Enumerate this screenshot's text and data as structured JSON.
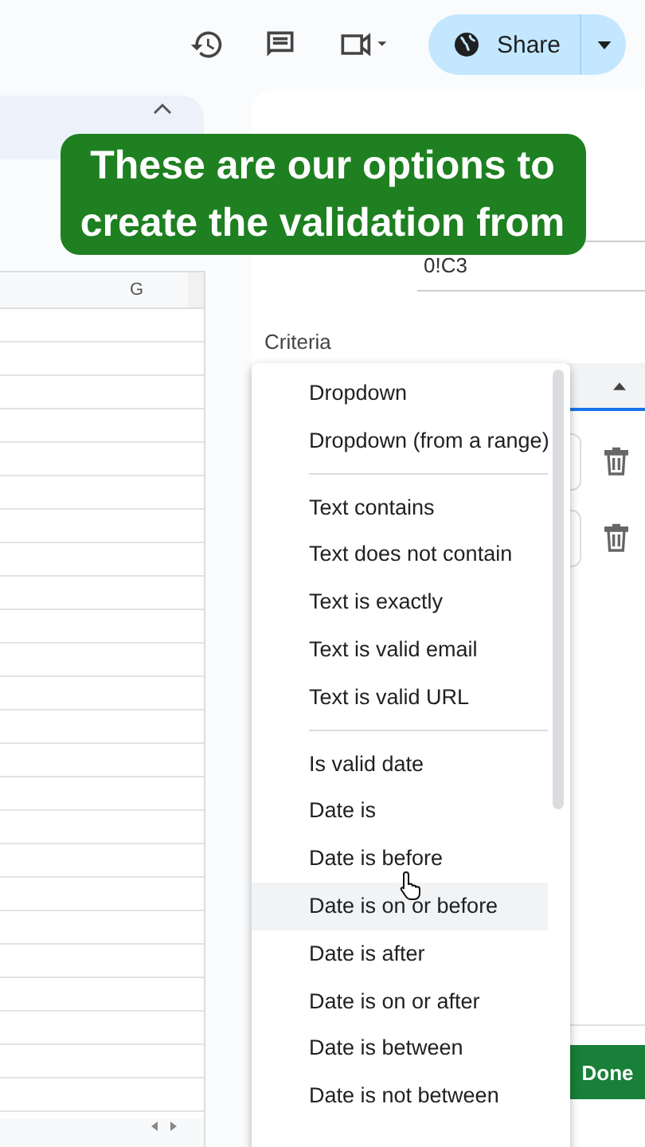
{
  "toolbar": {
    "share_label": "Share"
  },
  "caption": "These are our options to create the validation from",
  "sheet": {
    "column_header": "G"
  },
  "panel": {
    "range_text": "0!C3",
    "criteria_label": "Criteria",
    "done_label": "Done"
  },
  "menu": {
    "groups": [
      [
        {
          "label": "Dropdown",
          "highlighted": false
        },
        {
          "label": "Dropdown (from a range)",
          "highlighted": false
        }
      ],
      [
        {
          "label": "Text contains",
          "highlighted": false
        },
        {
          "label": "Text does not contain",
          "highlighted": false
        },
        {
          "label": "Text is exactly",
          "highlighted": false
        },
        {
          "label": "Text is valid email",
          "highlighted": false
        },
        {
          "label": "Text is valid URL",
          "highlighted": false
        }
      ],
      [
        {
          "label": "Is valid date",
          "highlighted": false
        },
        {
          "label": "Date is",
          "highlighted": false
        },
        {
          "label": "Date is before",
          "highlighted": false
        },
        {
          "label": "Date is on or before",
          "highlighted": true
        },
        {
          "label": "Date is after",
          "highlighted": false
        },
        {
          "label": "Date is on or after",
          "highlighted": false
        },
        {
          "label": "Date is between",
          "highlighted": false
        },
        {
          "label": "Date is not between",
          "highlighted": false
        }
      ]
    ]
  }
}
